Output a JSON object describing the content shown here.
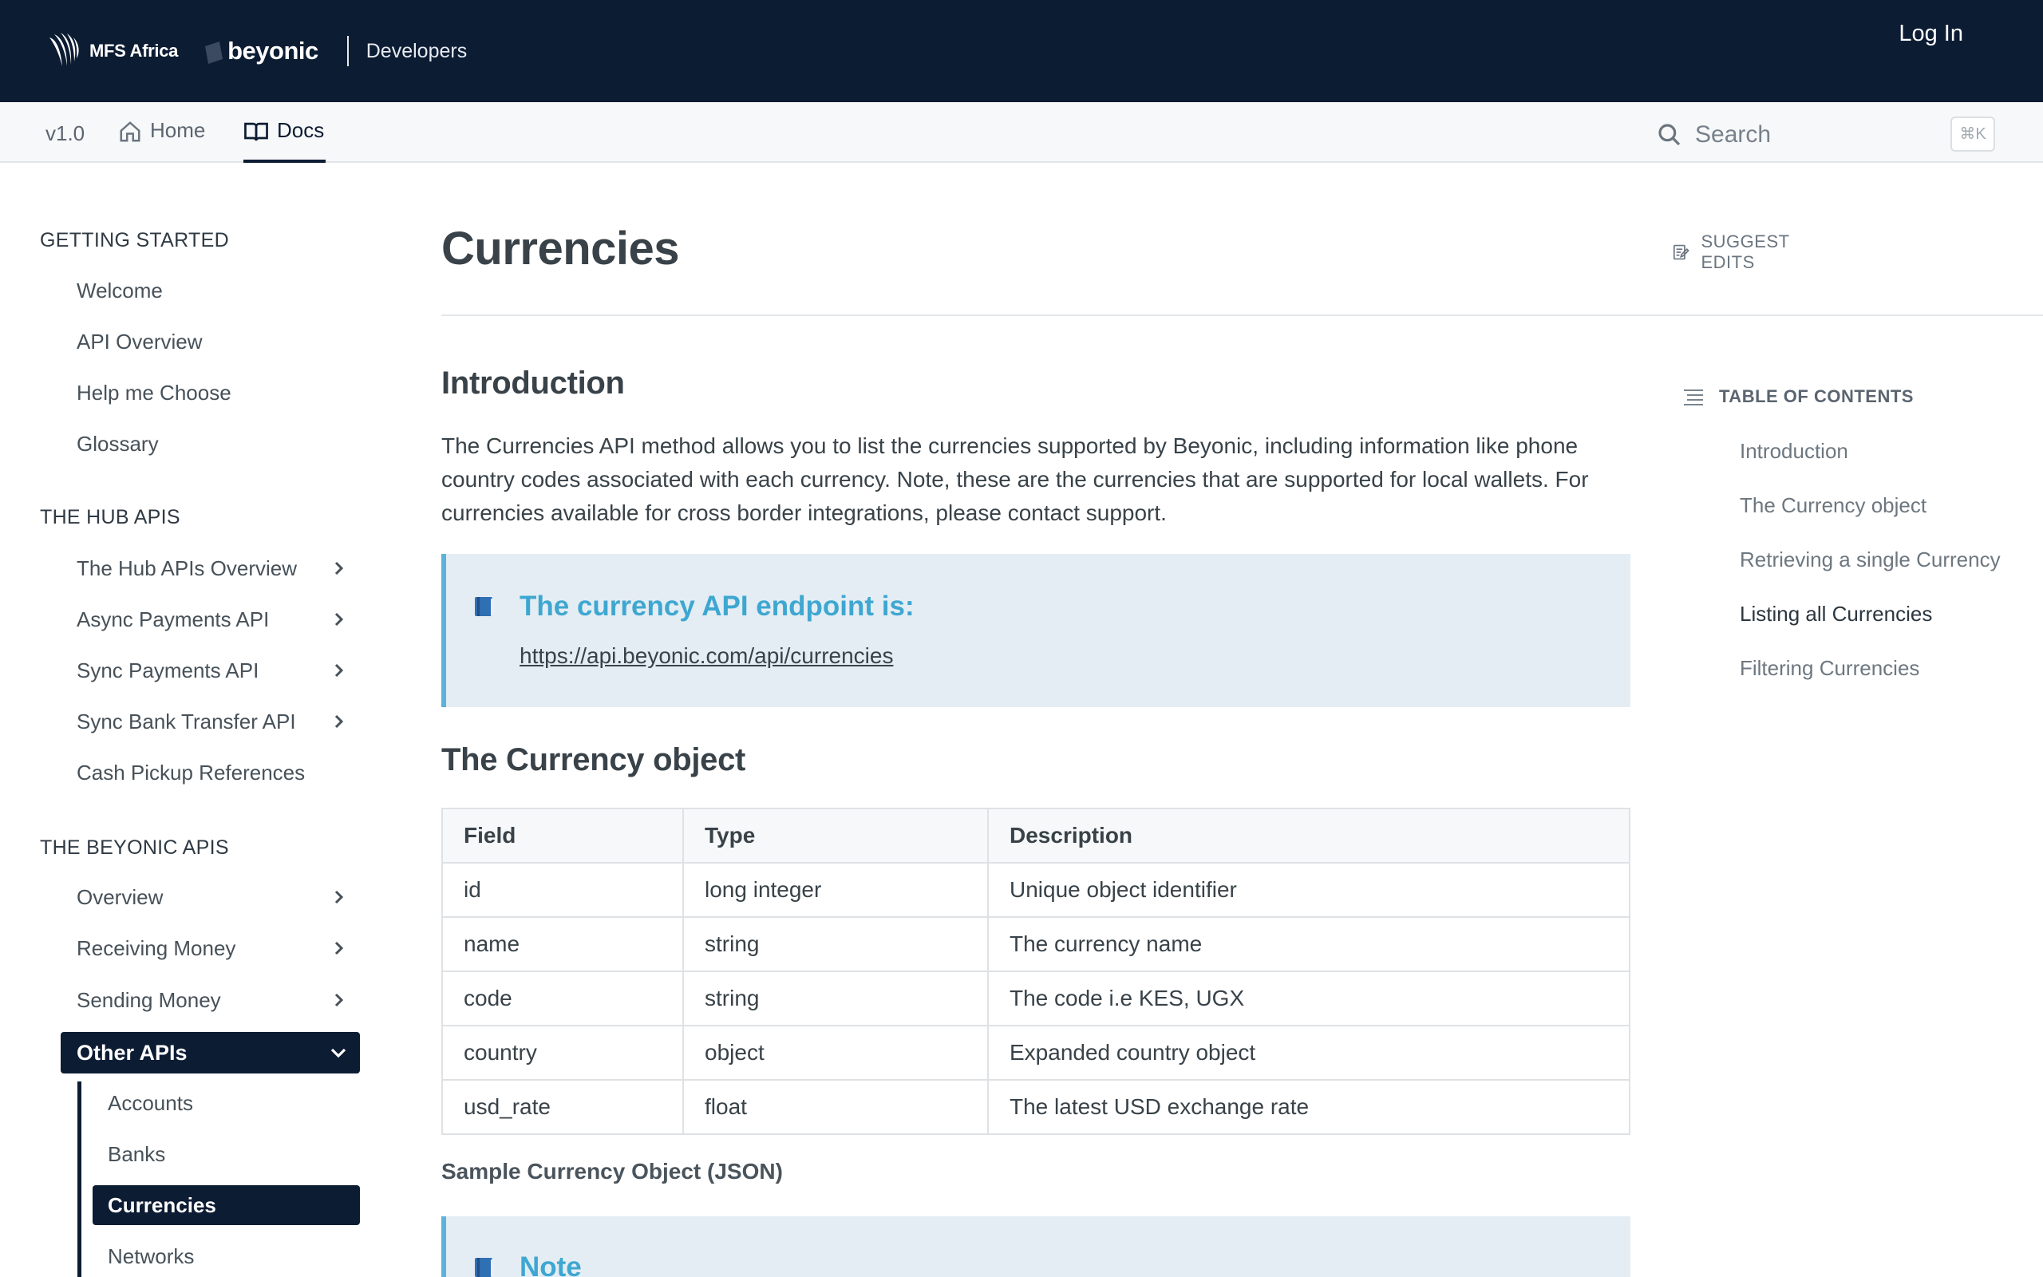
{
  "header": {
    "brand_mfs": "MFS Africa",
    "brand_beyonic": "beyonic",
    "section": "Developers",
    "login": "Log In",
    "bg_color": "#0c1c33"
  },
  "subnav": {
    "version": "v1.0",
    "tabs": [
      {
        "label": "Home",
        "icon": "home-icon"
      },
      {
        "label": "Docs",
        "icon": "book-icon",
        "active": true
      }
    ],
    "search_placeholder": "Search",
    "search_shortcut": "⌘K"
  },
  "sidebar": {
    "groups": [
      {
        "heading": "GETTING STARTED",
        "items": [
          "Welcome",
          "API Overview",
          "Help me Choose",
          "Glossary"
        ]
      },
      {
        "heading": "THE HUB APIS",
        "items": [
          "The Hub APIs Overview",
          "Async Payments API",
          "Sync Payments API",
          "Sync Bank Transfer API",
          "Cash Pickup References"
        ]
      },
      {
        "heading": "THE BEYONIC APIS",
        "items": [
          "Overview",
          "Receiving Money",
          "Sending Money"
        ]
      }
    ],
    "active_parent": "Other APIs",
    "sub_items": [
      "Accounts",
      "Banks",
      "Currencies",
      "Networks"
    ],
    "active_sub": "Currencies"
  },
  "main": {
    "title": "Currencies",
    "suggest_edits": "SUGGEST EDITS",
    "sections": {
      "intro_heading": "Introduction",
      "intro_text": "The Currencies API method allows you to list the currencies supported by Beyonic, including information like phone country codes associated with each currency. Note, these are the currencies that are supported for local wallets. For currencies available for cross border integrations, please contact support.",
      "callout_title": "The currency API endpoint is:",
      "callout_link": "https://api.beyonic.com/api/currencies",
      "object_heading": "The Currency object",
      "sample_label": "Sample Currency Object (JSON)",
      "note_title": "Note"
    },
    "table": {
      "headers": [
        "Field",
        "Type",
        "Description"
      ],
      "rows": [
        [
          "id",
          "long integer",
          "Unique object identifier"
        ],
        [
          "name",
          "string",
          "The currency name"
        ],
        [
          "code",
          "string",
          "The code i.e KES, UGX"
        ],
        [
          "country",
          "object",
          "Expanded country object"
        ],
        [
          "usd_rate",
          "float",
          "The latest USD exchange rate"
        ]
      ]
    }
  },
  "toc": {
    "heading": "TABLE OF CONTENTS",
    "items": [
      "Introduction",
      "The Currency object",
      "Retrieving a single Currency",
      "Listing all Currencies",
      "Filtering Currencies"
    ],
    "active": "Listing all Currencies"
  }
}
